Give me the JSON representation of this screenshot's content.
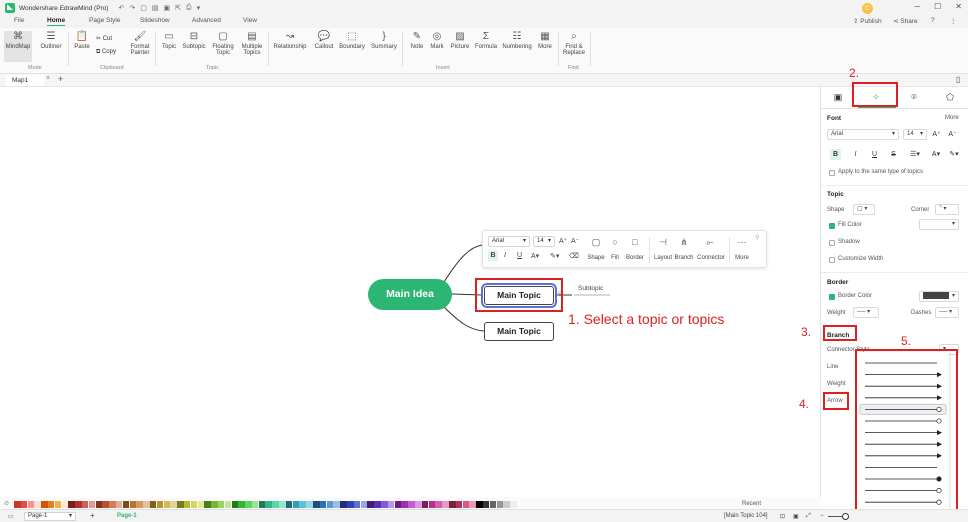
{
  "app": {
    "title": "Wondershare EdrawMind (Pro)",
    "avatar_letter": "C"
  },
  "title_controls": {
    "publish": "Publish",
    "share": "Share"
  },
  "menu_tabs": [
    "File",
    "Home",
    "Page Style",
    "Slideshow",
    "Advanced",
    "View"
  ],
  "ribbon": {
    "buttons": [
      {
        "label": "MindMap",
        "icon": "mindmap-icon"
      },
      {
        "label": "Outliner",
        "icon": "outliner-icon"
      },
      {
        "label": "Paste",
        "icon": "paste-icon"
      },
      {
        "label": "Cut",
        "icon": "cut-icon"
      },
      {
        "label": "Copy",
        "icon": "copy-icon"
      },
      {
        "label": "Format Painter",
        "icon": "format-painter-icon"
      },
      {
        "label": "Topic",
        "icon": "topic-icon"
      },
      {
        "label": "Subtopic",
        "icon": "subtopic-icon"
      },
      {
        "label": "Floating Topic",
        "icon": "floating-topic-icon"
      },
      {
        "label": "Multiple Topics",
        "icon": "multiple-topics-icon"
      },
      {
        "label": "Relationship",
        "icon": "relationship-icon"
      },
      {
        "label": "Callout",
        "icon": "callout-icon"
      },
      {
        "label": "Boundary",
        "icon": "boundary-icon"
      },
      {
        "label": "Summary",
        "icon": "summary-icon"
      },
      {
        "label": "Note",
        "icon": "note-icon"
      },
      {
        "label": "Mark",
        "icon": "mark-icon"
      },
      {
        "label": "Picture",
        "icon": "picture-icon"
      },
      {
        "label": "Formula",
        "icon": "formula-icon"
      },
      {
        "label": "Numbering",
        "icon": "numbering-icon"
      },
      {
        "label": "More",
        "icon": "more-icon"
      },
      {
        "label": "Find & Replace",
        "icon": "find-replace-icon"
      }
    ],
    "groups": [
      "Mode",
      "Clipboard",
      "Topic",
      "Insert",
      "Find"
    ]
  },
  "doc_tab": "Map1",
  "canvas": {
    "main_idea": "Main Idea",
    "topic1": "Main Topic",
    "topic2": "Main Topic",
    "subtopic": "Subtopic",
    "annotation": "1. Select a topic or topics"
  },
  "floating_toolbar": {
    "font": "Arial",
    "size": "14",
    "items": [
      "Shape",
      "Fill",
      "Border",
      "Layout",
      "Branch",
      "Connector",
      "More"
    ]
  },
  "steps": [
    "2.",
    "3.",
    "4.",
    "5."
  ],
  "panel": {
    "font": {
      "title": "Font",
      "more": "More",
      "family": "Arial",
      "size": "14",
      "apply_same": "Apply to the same type of topics"
    },
    "topic": {
      "title": "Topic",
      "shape": "Shape",
      "corner": "Corner",
      "fill_color": "Fill Color",
      "shadow": "Shadow",
      "custom_width": "Customize Width"
    },
    "border": {
      "title": "Border",
      "border_color": "Border Color",
      "weight": "Weight",
      "dashes": "Dashes"
    },
    "branch": {
      "title": "Branch",
      "connector_style": "Connector Style",
      "line": "Line",
      "weight": "Weight",
      "arrow": "Arrow"
    }
  },
  "status": {
    "page_select": "Page-1",
    "page_tab": "Page-1",
    "recent": "Recent",
    "selection": "[Main Topic 104]"
  },
  "colors": {
    "accent": "#2bb673",
    "annotation": "#e02020"
  }
}
